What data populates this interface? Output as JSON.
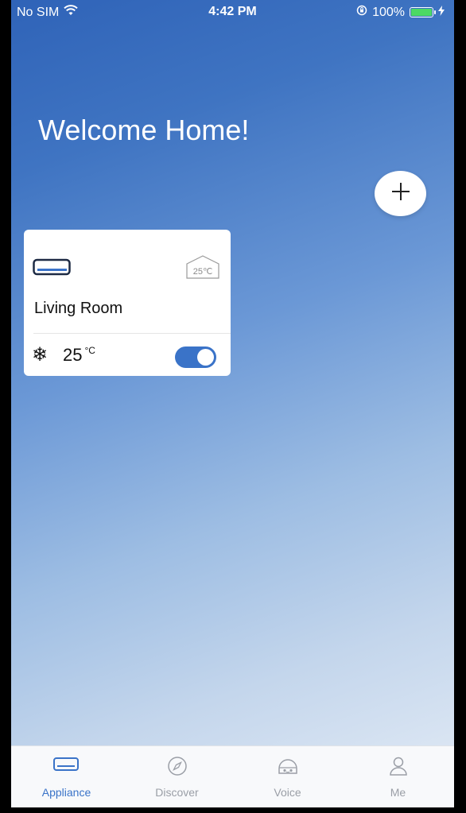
{
  "status_bar": {
    "carrier": "No SIM",
    "time": "4:42 PM",
    "battery": "100%"
  },
  "header": {
    "title": "Welcome Home!"
  },
  "add_button": {
    "icon": "plus-icon"
  },
  "device_card": {
    "device_icon": "air-conditioner-icon",
    "set_temp_badge": "25℃",
    "room_name": "Living Room",
    "mode_icon": "snowflake-icon",
    "temperature": "25",
    "temperature_unit": "°C",
    "power_on": true
  },
  "tabs": [
    {
      "label": "Appliance",
      "icon": "appliance-icon",
      "active": true
    },
    {
      "label": "Discover",
      "icon": "compass-icon",
      "active": false
    },
    {
      "label": "Voice",
      "icon": "voice-icon",
      "active": false
    },
    {
      "label": "Me",
      "icon": "person-icon",
      "active": false
    }
  ],
  "colors": {
    "accent": "#3a73c8",
    "tab_inactive": "#9a9ea6",
    "battery": "#4cd964"
  }
}
